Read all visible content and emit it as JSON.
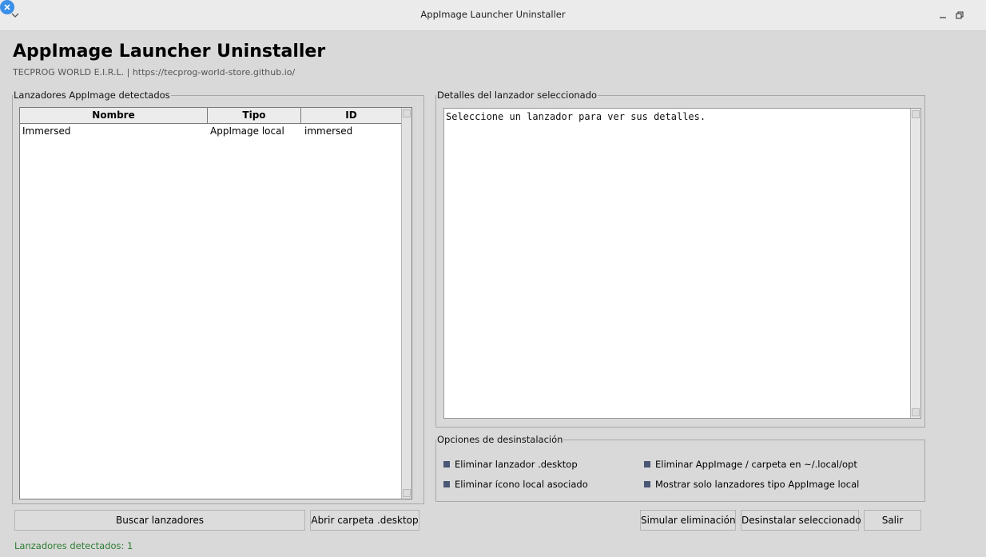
{
  "window": {
    "title": "AppImage Launcher Uninstaller",
    "close_color": "#3a8fe8"
  },
  "header": {
    "title": "AppImage Launcher Uninstaller",
    "subtitle": "TECPROG WORLD E.I.R.L.  |  https://tecprog-world-store.github.io/"
  },
  "launchers": {
    "legend": "Lanzadores AppImage detectados",
    "columns": [
      "Nombre",
      "Tipo",
      "ID"
    ],
    "rows": [
      [
        "Immersed",
        "AppImage local",
        "immersed"
      ]
    ],
    "search_button": "Buscar lanzadores",
    "open_folder_button": "Abrir carpeta .desktop"
  },
  "details": {
    "legend": "Detalles del lanzador seleccionado",
    "text": "Seleccione un lanzador para ver sus detalles."
  },
  "options": {
    "legend": "Opciones de desinstalación",
    "items": [
      {
        "label": "Eliminar lanzador .desktop",
        "checked": true
      },
      {
        "label": "Eliminar AppImage / carpeta en ~/.local/opt",
        "checked": true
      },
      {
        "label": "Eliminar ícono local asociado",
        "checked": true
      },
      {
        "label": "Mostrar solo lanzadores tipo AppImage local",
        "checked": true
      }
    ]
  },
  "actions": {
    "simulate": "Simular eliminación",
    "uninstall": "Desinstalar seleccionado",
    "exit": "Salir"
  },
  "status": {
    "text": "Lanzadores detectados: 1",
    "color": "#2e7d32"
  },
  "icons": {
    "window_menu": "chevron-down-icon",
    "minimize": "minimize-icon",
    "restore": "restore-icon",
    "close": "close-icon"
  }
}
